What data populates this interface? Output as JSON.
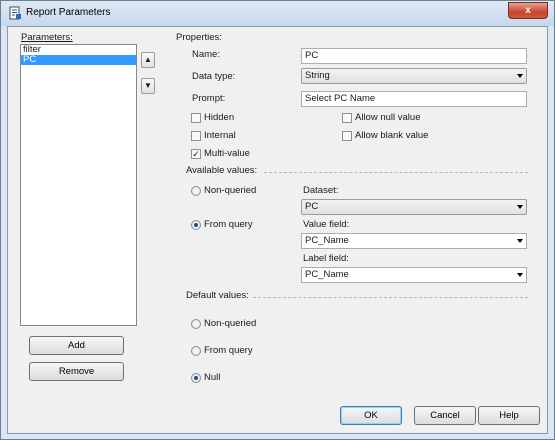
{
  "window": {
    "title": "Report Parameters",
    "close_label": "x"
  },
  "parameters": {
    "label": "Parameters:",
    "items": [
      {
        "label": "filter"
      },
      {
        "label": "PC"
      }
    ],
    "move_up_label": "▲",
    "move_down_label": "▼",
    "add_label": "Add",
    "remove_label": "Remove"
  },
  "properties": {
    "section_label": "Properties:",
    "name": {
      "label": "Name:",
      "value": "PC"
    },
    "data_type": {
      "label": "Data type:",
      "value": "String"
    },
    "prompt": {
      "label": "Prompt:",
      "value": "Select PC Name"
    },
    "hidden": {
      "label": "Hidden",
      "checked": false
    },
    "internal": {
      "label": "Internal",
      "checked": false
    },
    "multi_value": {
      "label": "Multi-value",
      "checked": true,
      "mark": "✓"
    },
    "allow_null": {
      "label": "Allow null value",
      "checked": false
    },
    "allow_blank": {
      "label": "Allow blank value",
      "checked": false
    }
  },
  "available_values": {
    "section_label": "Available values:",
    "non_queried_label": "Non-queried",
    "from_query_label": "From query",
    "selected": "from_query",
    "dataset_label": "Dataset:",
    "dataset_value": "PC",
    "value_field_label": "Value field:",
    "value_field_value": "PC_Name",
    "label_field_label": "Label field:",
    "label_field_value": "PC_Name"
  },
  "default_values": {
    "section_label": "Default values:",
    "non_queried_label": "Non-queried",
    "from_query_label": "From query",
    "null_label": "Null",
    "selected": "null"
  },
  "footer": {
    "ok_label": "OK",
    "cancel_label": "Cancel",
    "help_label": "Help"
  },
  "colors": {
    "selection": "#3399ff",
    "title_bar": "#c7d8ec",
    "close_button": "#c7432b"
  }
}
